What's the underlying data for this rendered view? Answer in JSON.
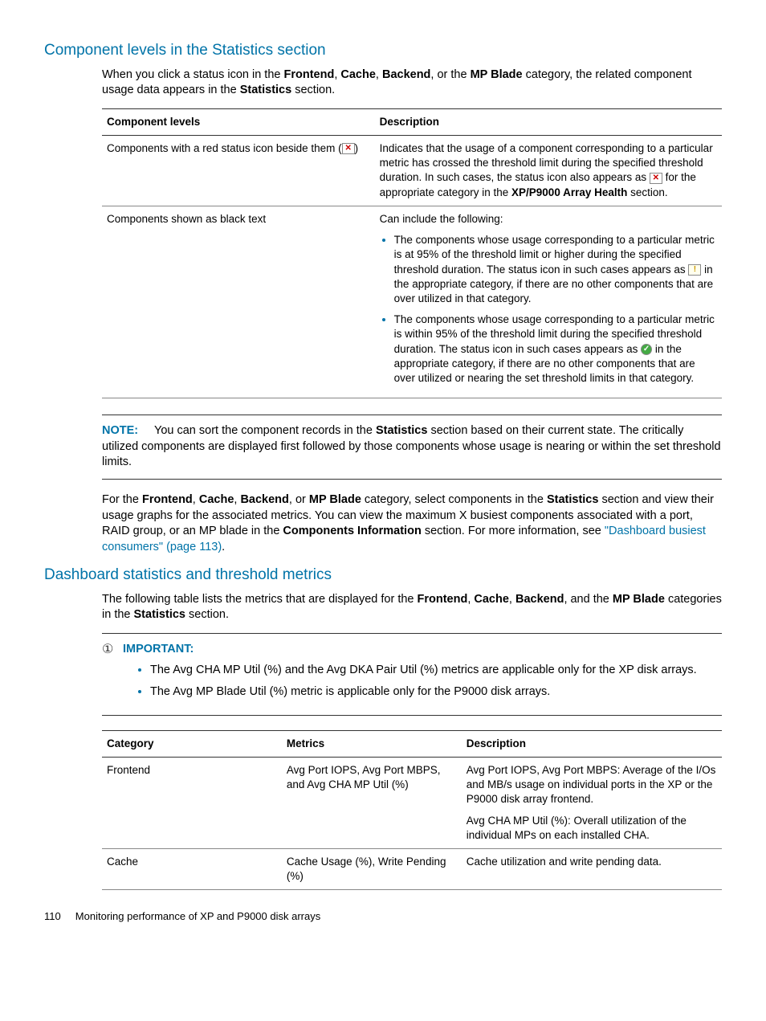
{
  "section1": {
    "title": "Component levels in the Statistics section",
    "intro_parts": [
      "When you click a status icon in the ",
      "Frontend",
      ", ",
      "Cache",
      ", ",
      "Backend",
      ", or the ",
      "MP Blade",
      " category, the related component usage data appears in the ",
      "Statistics",
      " section."
    ]
  },
  "table1": {
    "headers": [
      "Component levels",
      "Description"
    ],
    "row1": {
      "col1": "Components with a red status icon beside them (",
      "col1_after": ")",
      "desc_p1a": "Indicates that the usage of a component corresponding to a particular metric has crossed the threshold limit during the specified threshold duration. In such cases, the status icon also appears as ",
      "desc_p1b": " for the appropriate category in the ",
      "desc_bold": "XP/P9000 Array Health",
      "desc_p1c": " section."
    },
    "row2": {
      "col1": "Components shown as black text",
      "desc_intro": "Can include the following:",
      "li1a": "The components whose usage corresponding to a particular metric is at 95% of the threshold limit or higher during the specified threshold duration. The status icon in such cases appears as ",
      "li1b": " in the appropriate category, if there are no other components that are over utilized in that category.",
      "li2a": "The components whose usage corresponding to a particular metric is within 95% of the threshold limit during the specified threshold duration. The status icon in such cases appears as ",
      "li2b": " in the appropriate category, if there are no other components that are over utilized or nearing the set threshold limits in that category."
    }
  },
  "note": {
    "label": "NOTE:",
    "body_a": "You can sort the component records in the ",
    "body_bold1": "Statistics",
    "body_b": " section based on their current state. The critically utilized components are displayed first followed by those components whose usage is nearing or within the set threshold limits."
  },
  "para2": {
    "a": "For the ",
    "b1": "Frontend",
    "s1": ", ",
    "b2": "Cache",
    "s2": ", ",
    "b3": "Backend",
    "s3": ", or ",
    "b4": "MP Blade",
    "c": " category, select components in the ",
    "b5": "Statistics",
    "d": " section and view their usage graphs for the associated metrics. You can view the maximum X busiest components associated with a port, RAID group, or an MP blade in the ",
    "b6": "Components Information",
    "e": " section. For more information, see ",
    "link": "\"Dashboard busiest consumers\" (page 113)",
    "f": "."
  },
  "section2": {
    "title": "Dashboard statistics and threshold metrics",
    "intro_a": "The following table lists the metrics that are displayed for the ",
    "b1": "Frontend",
    "s1": ", ",
    "b2": "Cache",
    "s2": ", ",
    "b3": "Backend",
    "s3": ", and the ",
    "b4": "MP Blade",
    "intro_b": " categories in the ",
    "b5": "Statistics",
    "intro_c": " section."
  },
  "important": {
    "label": "IMPORTANT:",
    "li1": "The Avg CHA MP Util (%) and the Avg DKA Pair Util (%) metrics are applicable only for the XP disk arrays.",
    "li2": "The Avg MP Blade Util (%) metric is applicable only for the P9000 disk arrays."
  },
  "table2": {
    "headers": [
      "Category",
      "Metrics",
      "Description"
    ],
    "row1": {
      "c1": "Frontend",
      "c2": "Avg Port IOPS, Avg Port MBPS, and Avg CHA MP Util (%)",
      "c3a": "Avg Port IOPS, Avg Port MBPS: Average of the I/Os and MB/s usage on individual ports in the XP or the P9000 disk array frontend.",
      "c3b": "Avg CHA MP Util (%): Overall utilization of the individual MPs on each installed CHA."
    },
    "row2": {
      "c1": "Cache",
      "c2": "Cache Usage (%), Write Pending (%)",
      "c3": "Cache utilization and write pending data."
    }
  },
  "footer": {
    "page": "110",
    "text": "Monitoring performance of XP and P9000 disk arrays"
  },
  "icons": {
    "red": "✕",
    "warn": "!",
    "ok": "✓",
    "important": "①"
  }
}
